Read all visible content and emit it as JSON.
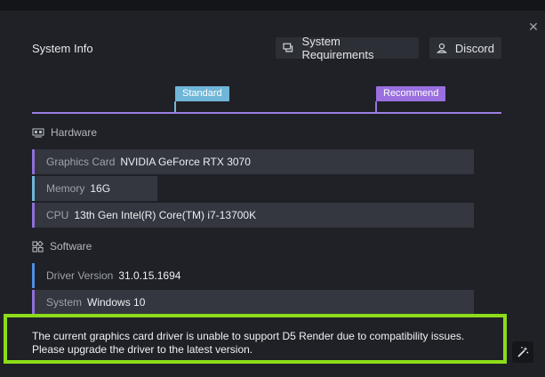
{
  "header": {
    "title": "System Info",
    "requirements_label": "System Requirements",
    "discord_label": "Discord",
    "close_glyph": "✕"
  },
  "scale": {
    "standard_label": "Standard",
    "recommend_label": "Recommend"
  },
  "hardware": {
    "heading": "Hardware",
    "items": [
      {
        "label": "Graphics Card",
        "value": "NVIDIA GeForce RTX 3070",
        "status_color": "#8f6fd8"
      },
      {
        "label": "Memory",
        "value": "16G",
        "status_color": "#6fb6d8"
      },
      {
        "label": "CPU",
        "value": "13th Gen Intel(R) Core(TM) i7-13700K",
        "status_color": "#8f6fd8"
      }
    ]
  },
  "software": {
    "heading": "Software",
    "items": [
      {
        "label": "Driver Version",
        "value": "31.0.15.1694",
        "status_color": "#4e8fe0"
      },
      {
        "label": "System",
        "value": "Windows 10",
        "status_color": "#8f6fd8"
      }
    ]
  },
  "warning": {
    "line1": "The current graphics card driver is unable to support D5 Render due to compatibility issues.",
    "line2": "Please upgrade the driver to the latest version.",
    "highlight_color": "#8ddc1a"
  },
  "icons": {
    "close": "close-icon",
    "requirements": "chat-icon",
    "discord": "user-icon",
    "hardware": "gpu-card-icon",
    "software": "apps-grid-icon",
    "magic": "magic-wand-icon"
  }
}
